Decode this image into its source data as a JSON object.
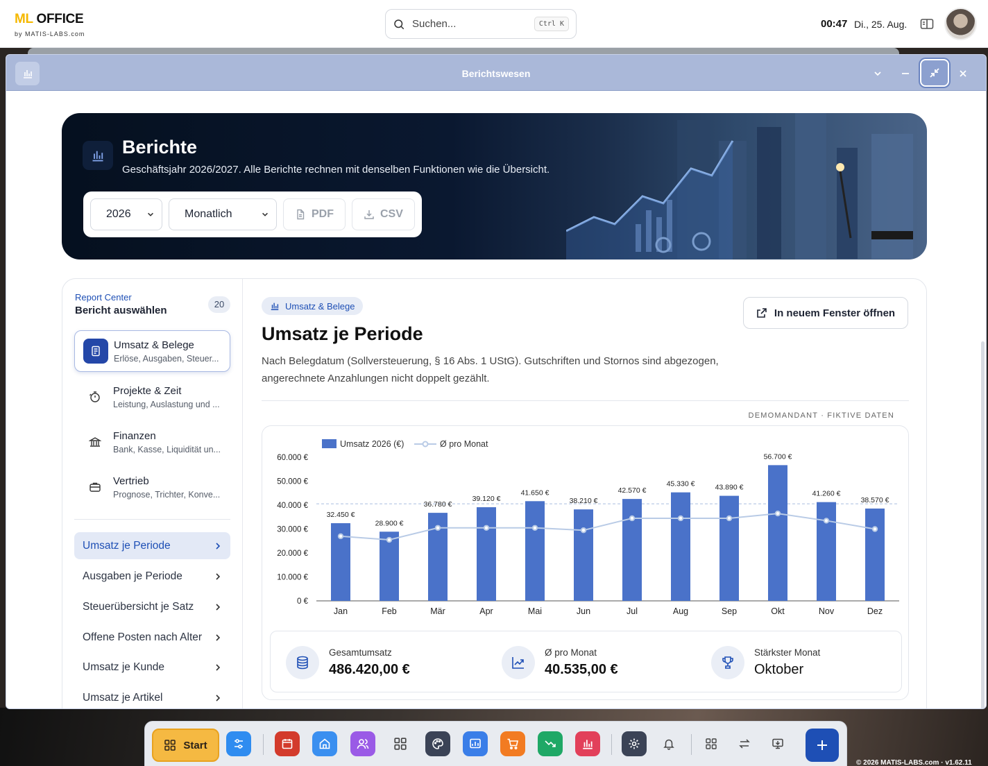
{
  "topbar": {
    "brand_ml": "ML",
    "brand_office": "OFFICE",
    "brand_sub": "by MATIS-LABS.com",
    "search_placeholder": "Suchen...",
    "search_shortcut": "Ctrl K",
    "time": "00:47",
    "date": "Di., 25. Aug."
  },
  "window": {
    "title": "Berichtswesen"
  },
  "hero": {
    "title": "Berichte",
    "subtitle": "Geschäftsjahr 2026/2027. Alle Berichte rechnen mit denselben Funktionen wie die Übersicht.",
    "year_value": "2026",
    "period_value": "Monatlich",
    "pdf_label": "PDF",
    "csv_label": "CSV"
  },
  "sidebar": {
    "label": "Report Center",
    "title": "Bericht auswählen",
    "count": "20",
    "categories": [
      {
        "name": "Umsatz & Belege",
        "desc": "Erlöse, Ausgaben, Steuer...",
        "icon": "receipt-icon"
      },
      {
        "name": "Projekte & Zeit",
        "desc": "Leistung, Auslastung und ...",
        "icon": "timer-icon"
      },
      {
        "name": "Finanzen",
        "desc": "Bank, Kasse, Liquidität un...",
        "icon": "bank-icon"
      },
      {
        "name": "Vertrieb",
        "desc": "Prognose, Trichter, Konve...",
        "icon": "briefcase-icon"
      }
    ],
    "reports": [
      {
        "label": "Umsatz je Periode"
      },
      {
        "label": "Ausgaben je Periode"
      },
      {
        "label": "Steuerübersicht je Satz"
      },
      {
        "label": "Offene Posten nach Alter"
      },
      {
        "label": "Umsatz je Kunde"
      },
      {
        "label": "Umsatz je Artikel"
      }
    ]
  },
  "main": {
    "chip": "Umsatz & Belege",
    "open_button": "In neuem Fenster öffnen",
    "title": "Umsatz je Periode",
    "description": "Nach Belegdatum (Sollversteuerung, § 16 Abs. 1 UStG). Gutschriften und Stornos sind abgezogen, angerechnete Anzahlungen nicht doppelt gezählt.",
    "demo_note": "DEMOMANDANT · FIKTIVE DATEN"
  },
  "chart_data": {
    "type": "bar",
    "categories": [
      "Jan",
      "Feb",
      "Mär",
      "Apr",
      "Mai",
      "Jun",
      "Jul",
      "Aug",
      "Sep",
      "Okt",
      "Nov",
      "Dez"
    ],
    "series": [
      {
        "name": "Umsatz 2026 (€)",
        "type": "bar",
        "values": [
          32450,
          28900,
          36780,
          39120,
          41650,
          38210,
          42570,
          45330,
          43890,
          56700,
          41260,
          38570
        ],
        "color": "#4a72c9"
      },
      {
        "name": "Ø pro Monat",
        "type": "line",
        "values": [
          27000,
          25500,
          30500,
          30500,
          30500,
          29500,
          34500,
          34500,
          34500,
          36500,
          33500,
          30000
        ],
        "color": "#b9cbe6"
      }
    ],
    "data_labels": [
      "32.450 €",
      "28.900 €",
      "36.780 €",
      "39.120 €",
      "41.650 €",
      "38.210 €",
      "42.570 €",
      "45.330 €",
      "43.890 €",
      "56.700 €",
      "41.260 €",
      "38.570 €"
    ],
    "y_ticks": [
      "0 €",
      "10.000 €",
      "20.000 €",
      "30.000 €",
      "40.000 €",
      "50.000 €",
      "60.000 €"
    ],
    "ylim": [
      0,
      60000
    ],
    "reference_line": 40535,
    "legend_position": "top-left",
    "grid": false
  },
  "stats": [
    {
      "label": "Gesamtumsatz",
      "value": "486.420,00 €",
      "icon": "database-icon"
    },
    {
      "label": "Ø pro Monat",
      "value": "40.535,00 €",
      "icon": "trending-up-icon"
    },
    {
      "label": "Stärkster Monat",
      "value": "Oktober",
      "icon": "trophy-icon"
    }
  ],
  "dock": {
    "start_label": "Start",
    "copyright": "© 2026 MATIS-LABS.com · v1.62.11"
  },
  "colors": {
    "accent": "#1e4fb5",
    "bar": "#4a72c9",
    "titlebar": "#aab8d9",
    "start": "#f5b942"
  }
}
